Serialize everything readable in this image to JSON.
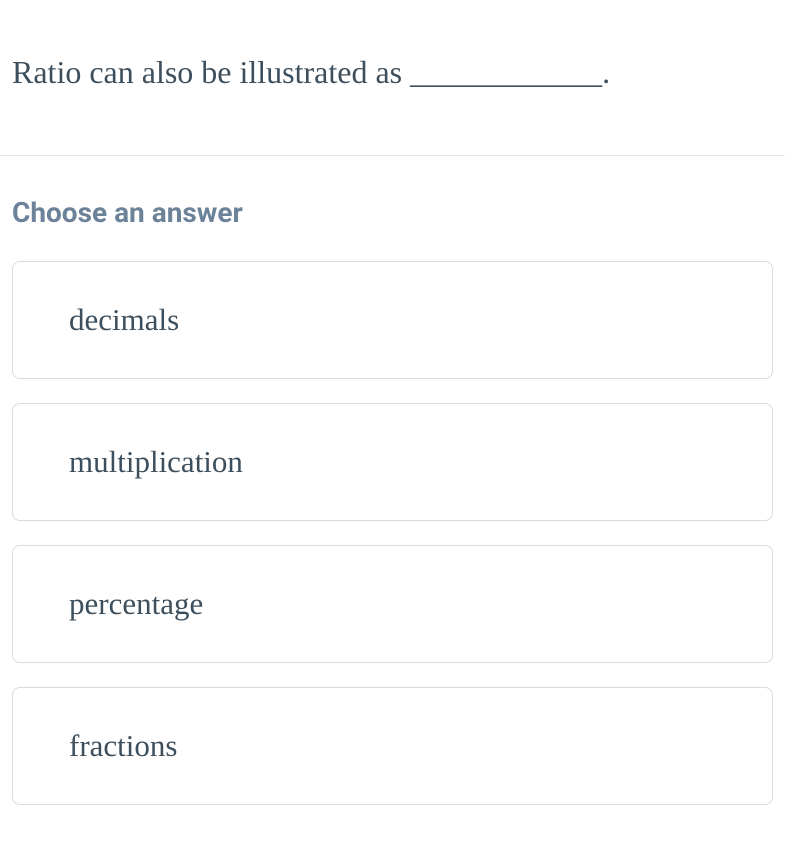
{
  "question": "Ratio can also be illustrated as ____________.",
  "choose_label": "Choose an answer",
  "options": [
    {
      "label": "decimals"
    },
    {
      "label": "multiplication"
    },
    {
      "label": "percentage"
    },
    {
      "label": "fractions"
    }
  ]
}
